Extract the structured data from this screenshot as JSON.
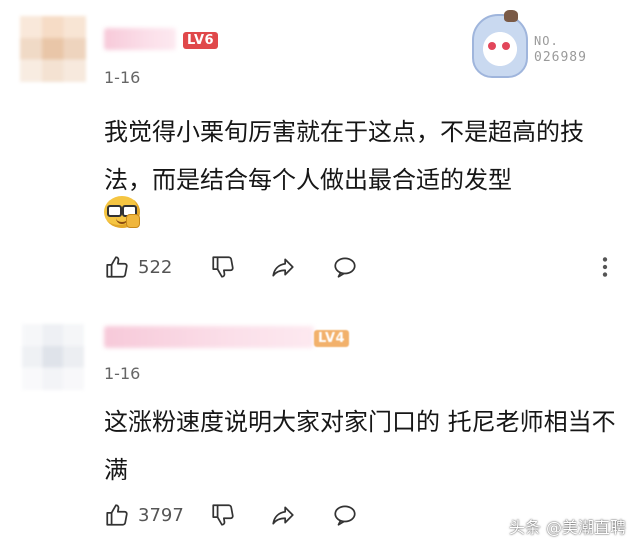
{
  "comments": [
    {
      "level": "LV6",
      "date": "1-16",
      "text": "我觉得小栗旬厉害就在于这点，不是超高的技法，而是结合每个人做出最合适的发型",
      "likes": "522",
      "badge": {
        "label": "NO.",
        "number": "026989"
      }
    },
    {
      "level": "LV4",
      "date": "1-16",
      "text": "这涨粉速度说明大家对家门口的 托尼老师相当不满",
      "likes": "3797"
    }
  ],
  "watermark": "头条 @美潮直聘",
  "colors": {
    "level_red": "#e0484a",
    "level_orange": "#f2b16b",
    "nick_pink": "#f7c9d9"
  }
}
